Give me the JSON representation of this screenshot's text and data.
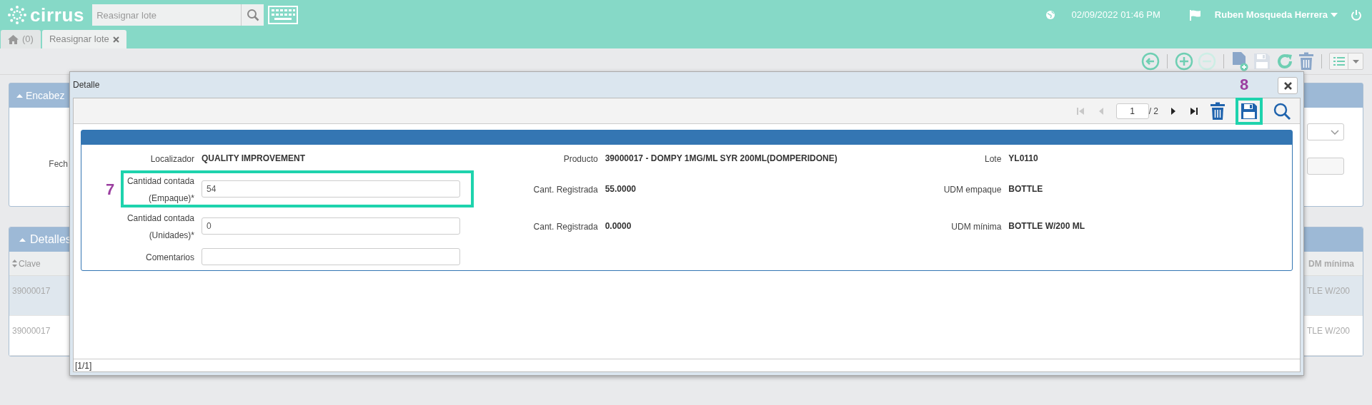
{
  "header": {
    "logo": "cirrus",
    "search": {
      "placeholder": "Reasignar lote"
    },
    "datetime": "02/09/2022 01:46 PM",
    "user": "Ruben Mosqueda Herrera"
  },
  "tabs": [
    {
      "kind": "home",
      "label": "(0)",
      "selected": false
    },
    {
      "kind": "page",
      "label": "Reasignar lote",
      "selected": true
    }
  ],
  "toolbar": [
    {
      "kind": "back",
      "disabled": false
    },
    {
      "kind": "separator"
    },
    {
      "kind": "add",
      "disabled": false
    },
    {
      "kind": "remove",
      "disabled": true
    },
    {
      "kind": "separator"
    },
    {
      "kind": "new",
      "disabled": false
    },
    {
      "kind": "save",
      "disabled": true
    },
    {
      "kind": "refresh",
      "disabled": false
    },
    {
      "kind": "delete",
      "disabled": false
    },
    {
      "kind": "separator"
    },
    {
      "kind": "menu",
      "disabled": false
    }
  ],
  "header_panel": {
    "title": "Encabez",
    "label": "Fech"
  },
  "details_panel": {
    "title": "Detalles",
    "column_1": "Clave",
    "column_last": "DM mínima",
    "rows": [
      {
        "cells": [
          "39000017",
          "TLE W/200"
        ],
        "selected": true
      },
      {
        "cells": [
          "39000017",
          "TLE W/200"
        ],
        "selected": false
      }
    ]
  },
  "modal": {
    "title": "Detalle",
    "toolbar": [
      {
        "kind": "first",
        "disabled": true
      },
      {
        "kind": "prev",
        "disabled": true
      },
      {
        "kind": "page",
        "value": "1"
      },
      {
        "kind": "count",
        "text": "/ 2"
      },
      {
        "kind": "next",
        "disabled": false
      },
      {
        "kind": "last",
        "disabled": false
      },
      {
        "kind": "delete",
        "disabled": false
      },
      {
        "kind": "save",
        "disabled": false,
        "highlighted": true,
        "callout": "8"
      },
      {
        "kind": "search",
        "disabled": false
      }
    ],
    "form_rows": [
      [
        {
          "kind": "display",
          "label": "Localizador",
          "value": "QUALITY IMPROVEMENT"
        },
        {
          "kind": "display",
          "label": "Producto",
          "value": "39000017 - DOMPY 1MG/ML SYR 200ML(DOMPERIDONE)"
        },
        {
          "kind": "display",
          "label": "Lote",
          "value": "YL0110"
        }
      ],
      [
        {
          "kind": "input",
          "label": "Cantidad contada (Empaque)*",
          "value": "54",
          "highlighted": true,
          "callout": "7"
        },
        {
          "kind": "display",
          "label": "Cant. Registrada",
          "value": "55.0000"
        },
        {
          "kind": "display",
          "label": "UDM empaque",
          "value": "BOTTLE"
        }
      ],
      [
        {
          "kind": "input",
          "label": "Cantidad contada (Unidades)*",
          "value": "0",
          "highlighted": false
        },
        {
          "kind": "display",
          "label": "Cant. Registrada",
          "value": "0.0000"
        },
        {
          "kind": "display",
          "label": "UDM mínima",
          "value": "BOTTLE W/200 ML"
        }
      ],
      [
        {
          "kind": "input",
          "label": "Comentarios",
          "highlighted": false
        }
      ]
    ],
    "footer": "[1/1]"
  }
}
